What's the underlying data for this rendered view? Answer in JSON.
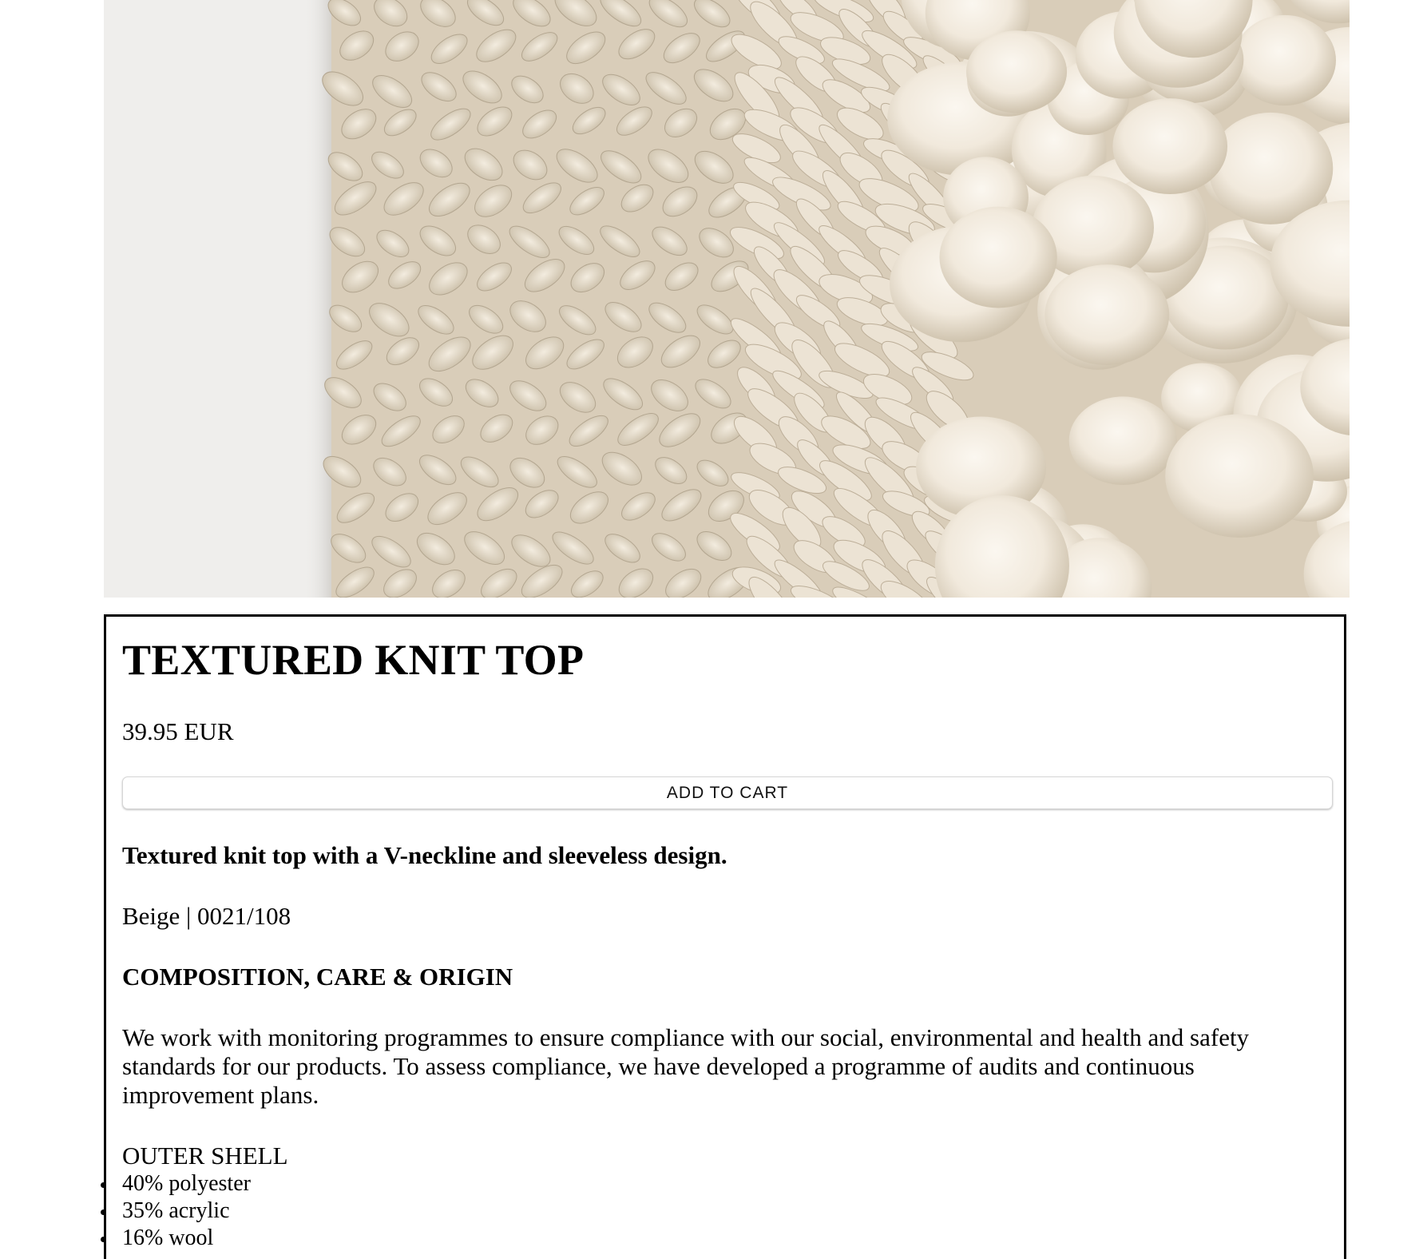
{
  "product": {
    "image_icon": "knit-fabric-closeup-image",
    "title": "TEXTURED KNIT TOP",
    "price": "39.95 EUR",
    "add_to_cart_label": "ADD TO CART",
    "short_description": "Textured knit top with a V-neckline and sleeveless design.",
    "color_ref": "Beige | 0021/108",
    "composition_heading": "COMPOSITION, CARE & ORIGIN",
    "compliance_text": "We work with monitoring programmes to ensure compliance with our social, environmental and health and safety standards for our products. To assess compliance, we have developed a programme of audits and continuous improvement plans.",
    "outer_shell_label": "OUTER SHELL",
    "composition": [
      "40% polyester",
      "35% acrylic",
      "16% wool"
    ]
  },
  "colors": {
    "image_background": "#efeeec",
    "yarn_base": "#e6dccb",
    "yarn_light": "#f4ede2",
    "yarn_shadow": "#b8ab96",
    "border": "#000000"
  }
}
